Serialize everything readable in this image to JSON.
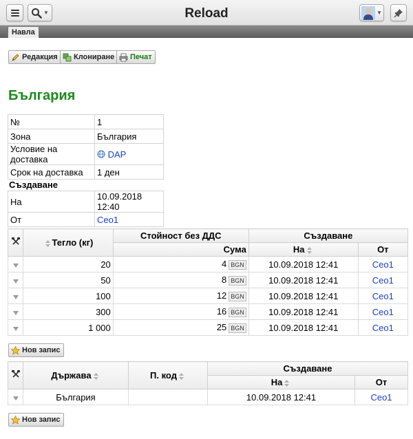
{
  "app": {
    "title": "Reload"
  },
  "tabs": [
    {
      "label": "Навла"
    }
  ],
  "toolbar": {
    "edit_label": "Редакция",
    "clone_label": "Клониране",
    "print_label": "Печат"
  },
  "page": {
    "title": "България"
  },
  "properties": {
    "rows": [
      {
        "label": "№",
        "value": "1"
      },
      {
        "label": "Зона",
        "value": "България"
      },
      {
        "label": "Условие на доставка",
        "value": "DAP"
      },
      {
        "label": "Срок на доставка",
        "value": "1 ден"
      }
    ]
  },
  "created": {
    "section_label": "Създаване",
    "on_label": "На",
    "on_value": "10.09.2018 12:40",
    "by_label": "От",
    "by_value": "Ceo1"
  },
  "rates_table": {
    "headers": {
      "weight": "Тегло (кг)",
      "value_group": "Стойност без ДДС",
      "amount": "Сума",
      "created_group": "Създаване",
      "on": "На",
      "by": "От"
    },
    "rows": [
      {
        "weight": "20",
        "amount": "4",
        "currency": "BGN",
        "on": "10.09.2018 12:41",
        "by": "Ceo1"
      },
      {
        "weight": "50",
        "amount": "8",
        "currency": "BGN",
        "on": "10.09.2018 12:41",
        "by": "Ceo1"
      },
      {
        "weight": "100",
        "amount": "12",
        "currency": "BGN",
        "on": "10.09.2018 12:41",
        "by": "Ceo1"
      },
      {
        "weight": "300",
        "amount": "16",
        "currency": "BGN",
        "on": "10.09.2018 12:41",
        "by": "Ceo1"
      },
      {
        "weight": "1 000",
        "amount": "25",
        "currency": "BGN",
        "on": "10.09.2018 12:41",
        "by": "Ceo1"
      }
    ],
    "new_record_label": "Нов запис"
  },
  "countries_table": {
    "headers": {
      "country": "Държава",
      "postcode": "П. код",
      "created_group": "Създаване",
      "on": "На",
      "by": "От"
    },
    "rows": [
      {
        "country": "България",
        "postcode": "",
        "on": "10.09.2018 12:41",
        "by": "Ceo1"
      }
    ],
    "new_record_label": "Нов запис"
  },
  "icons": {
    "menu": "hamburger-icon",
    "search": "search-icon",
    "user": "avatar",
    "pin": "pin-icon",
    "edit": "pencil-icon",
    "clone": "clone-icon",
    "print": "printer-icon",
    "globe": "globe-icon",
    "tools": "tools-icon",
    "star": "star-icon"
  },
  "colors": {
    "title_green": "#1b8a1b",
    "link_blue": "#1a3fc6"
  }
}
